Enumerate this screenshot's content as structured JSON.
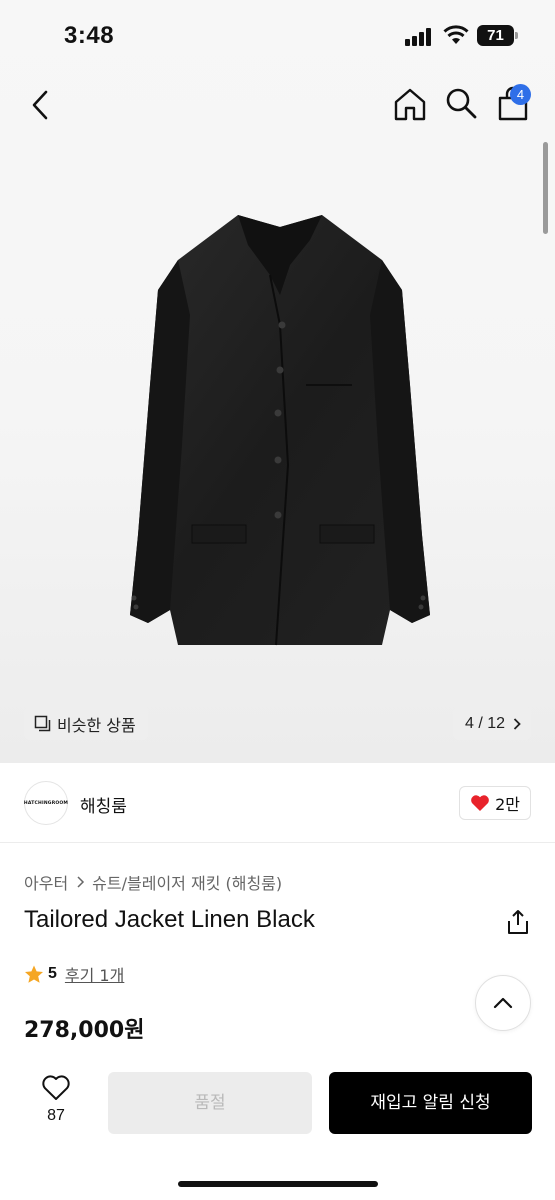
{
  "status_bar": {
    "time": "3:48",
    "battery": "71"
  },
  "nav": {
    "back_icon": "chevron-left-icon",
    "home_icon": "home-icon",
    "search_icon": "search-icon",
    "cart_icon": "cart-icon",
    "cart_badge": "4",
    "badge_color": "#2f6fe8"
  },
  "gallery": {
    "similar_label": "비슷한 상품",
    "pager": "4 / 12"
  },
  "brand": {
    "logo_text": "HATCHINGROOM",
    "name": "해칭룸",
    "likes": "2만"
  },
  "product": {
    "breadcrumb": [
      "아우터",
      "슈트/블레이저 재킷 (해칭룸)"
    ],
    "title": "Tailored Jacket Linen Black",
    "rating": "5",
    "review_label": "후기 1개",
    "price": "278,000원"
  },
  "bottom": {
    "wish_count": "87",
    "soldout_label": "품절",
    "restock_label": "재입고 알림 신청"
  },
  "colors": {
    "accent_black": "#000000",
    "heart_red": "#e8232b",
    "star": "#f5a623"
  }
}
